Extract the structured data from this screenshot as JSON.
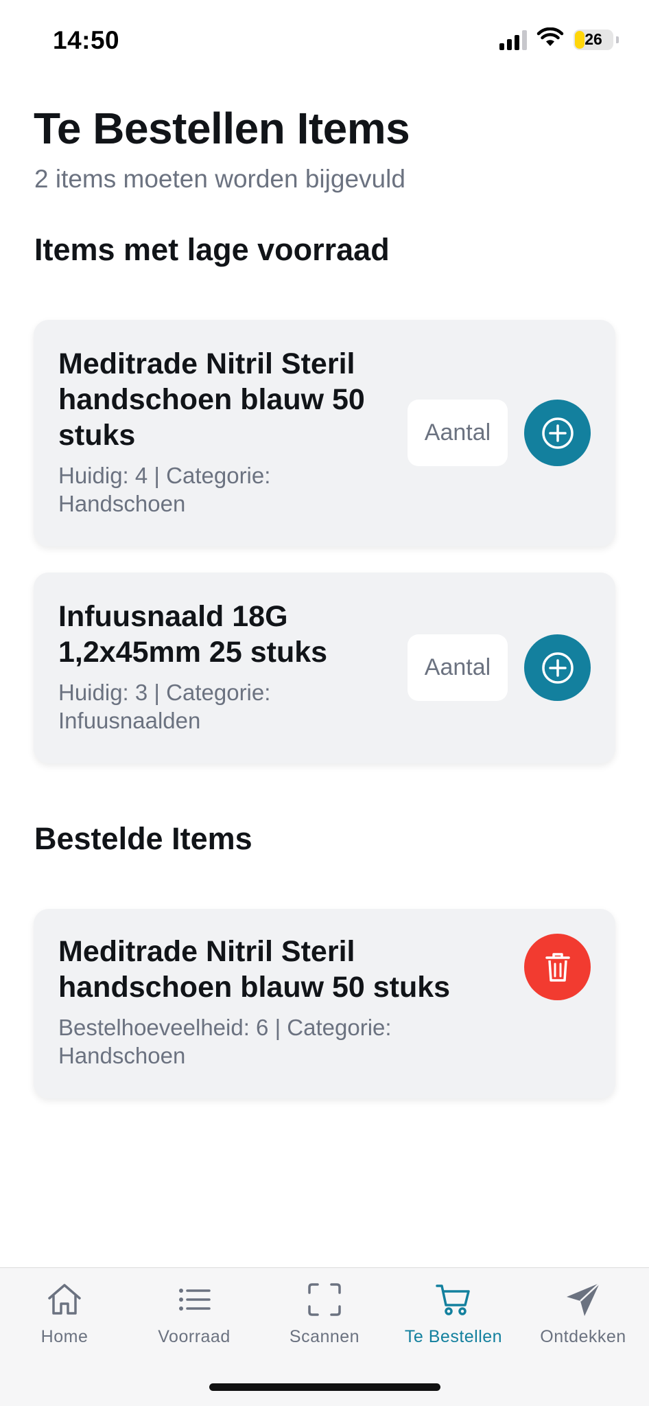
{
  "status_bar": {
    "time": "14:50",
    "battery": "26",
    "battery_level": 0.26
  },
  "header": {
    "title": "Te Bestellen Items",
    "subtitle": "2 items moeten worden bijgevuld"
  },
  "low_stock": {
    "title": "Items met lage voorraad",
    "items": [
      {
        "name": "Meditrade Nitril Steril handschoen blauw 50 stuks",
        "meta": "Huidig: 4 | Categorie: Handschoen",
        "qty_placeholder": "Aantal"
      },
      {
        "name": "Infuusnaald 18G 1,2x45mm 25 stuks",
        "meta": "Huidig: 3 | Categorie: Infuusnaalden",
        "qty_placeholder": "Aantal"
      }
    ]
  },
  "ordered": {
    "title": "Bestelde Items",
    "items": [
      {
        "name": "Meditrade Nitril Steril handschoen blauw 50 stuks",
        "meta": "Bestelhoeveelheid: 6 | Categorie: Handschoen"
      }
    ]
  },
  "tab_bar": {
    "active_tab": "Te Bestellen",
    "tabs": [
      {
        "label": "Home",
        "icon": "home-icon"
      },
      {
        "label": "Voorraad",
        "icon": "list-icon"
      },
      {
        "label": "Scannen",
        "icon": "scan-icon"
      },
      {
        "label": "Te Bestellen",
        "icon": "cart-icon"
      },
      {
        "label": "Ontdekken",
        "icon": "paper-plane-icon"
      }
    ]
  },
  "colors": {
    "accent": "#13809e",
    "danger": "#f23b30",
    "card_background": "#f1f2f4",
    "muted_text": "#6b7280",
    "battery_fill": "#ffd60a"
  }
}
